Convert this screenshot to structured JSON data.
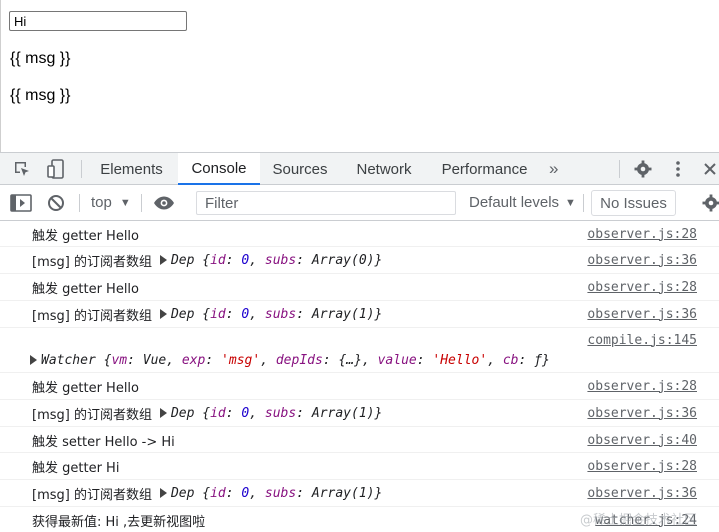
{
  "page": {
    "input_value": "Hi",
    "template_lines": [
      "{{ msg }}",
      "{{ msg }}"
    ]
  },
  "devtools": {
    "tabs": [
      "Elements",
      "Console",
      "Sources",
      "Network",
      "Performance"
    ],
    "active_tab": "Console",
    "more_tabs_glyph": "»",
    "icons": [
      "inspect-element-icon",
      "device-toolbar-icon",
      "settings-gear-icon",
      "more-menu-icon",
      "close-icon"
    ]
  },
  "console_toolbar": {
    "context": "top",
    "filter_placeholder": "Filter",
    "levels": "Default levels",
    "issues": "No Issues"
  },
  "log": [
    {
      "type": "text",
      "text": "触发 getter Hello",
      "source": "observer.js:28"
    },
    {
      "type": "dep",
      "prefix": "[msg] 的订阅者数组",
      "obj": "Dep",
      "subs": "Array(0)",
      "id": "0",
      "source": "observer.js:36"
    },
    {
      "type": "text",
      "text": "触发 getter Hello",
      "source": "observer.js:28"
    },
    {
      "type": "dep",
      "prefix": "[msg] 的订阅者数组",
      "obj": "Dep",
      "subs": "Array(1)",
      "id": "0",
      "source": "observer.js:36"
    },
    {
      "type": "watcher",
      "obj": "Watcher",
      "vm": "Vue",
      "exp": "'msg'",
      "depIds": "{…}",
      "value": "'Hello'",
      "cb": "ƒ",
      "source": "compile.js:145"
    },
    {
      "type": "text",
      "text": "触发 getter Hello",
      "source": "observer.js:28"
    },
    {
      "type": "dep",
      "prefix": "[msg] 的订阅者数组",
      "obj": "Dep",
      "subs": "Array(1)",
      "id": "0",
      "source": "observer.js:36"
    },
    {
      "type": "text",
      "text": "触发 setter Hello -> Hi",
      "source": "observer.js:40"
    },
    {
      "type": "text",
      "text": "触发 getter Hi",
      "source": "observer.js:28"
    },
    {
      "type": "dep",
      "prefix": "[msg] 的订阅者数组",
      "obj": "Dep",
      "subs": "Array(1)",
      "id": "0",
      "source": "observer.js:36"
    },
    {
      "type": "text",
      "text": "获得最新值: Hi ,去更新视图啦",
      "source": "watcher.js:24"
    }
  ],
  "watermark": "@稀土掘金技术社区"
}
